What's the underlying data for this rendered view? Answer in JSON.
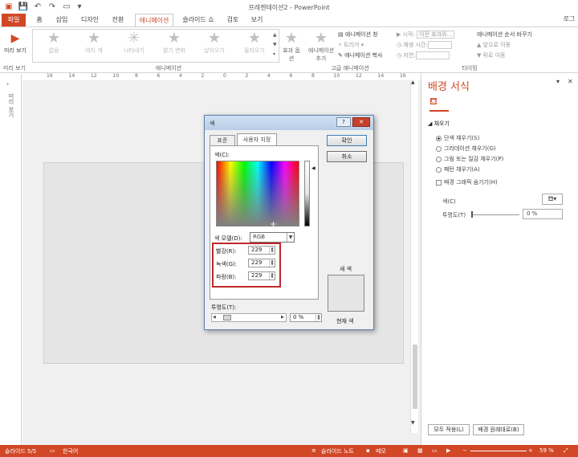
{
  "window": {
    "title": "프레젠테이션2 - PowerPoint",
    "login": "로그인"
  },
  "tabs": [
    {
      "label": "파일",
      "kind": "file"
    },
    {
      "label": "홈",
      "kind": ""
    },
    {
      "label": "삽입",
      "kind": ""
    },
    {
      "label": "디자인",
      "kind": ""
    },
    {
      "label": "전환",
      "kind": ""
    },
    {
      "label": "애니메이션",
      "kind": "active"
    },
    {
      "label": "슬라이드 쇼",
      "kind": ""
    },
    {
      "label": "검토",
      "kind": ""
    },
    {
      "label": "보기",
      "kind": ""
    }
  ],
  "ribbon": {
    "preview_label": "미리 보기",
    "preview_group": "미리 보기",
    "animations": [
      "없음",
      "여러 개",
      "나타내기",
      "밝기 변화",
      "날아오기",
      "올라오기"
    ],
    "effect_options": "효과 옵션",
    "animation_group": "애니메이션",
    "add_animation": "애니메이션 추가",
    "animation_pane": "애니메이션 창",
    "trigger": "트리거",
    "animation_painter": "애니메이션 복사",
    "advanced_group": "고급 애니메이션",
    "start_label": "시작:",
    "start_value": "이전 효과와...",
    "duration_label": "재생 시간:",
    "delay_label": "지연:",
    "reorder_title": "애니메이션 순서 바꾸기",
    "move_earlier": "앞으로 이동",
    "move_later": "뒤로 이동",
    "timing_group": "타이밍"
  },
  "left_strip": {
    "label": "미리 보기"
  },
  "ruler": {
    "marks": [
      "16",
      "14",
      "12",
      "10",
      "8",
      "6",
      "4",
      "2",
      "0",
      "2",
      "4",
      "6",
      "8",
      "10",
      "12",
      "14",
      "16"
    ]
  },
  "pane": {
    "title": "배경 서식",
    "section": "채우기",
    "options": [
      {
        "label": "단색 채우기(S)",
        "selected": true
      },
      {
        "label": "그라데이션 채우기(G)",
        "selected": false
      },
      {
        "label": "그림 또는 질감 채우기(P)",
        "selected": false
      },
      {
        "label": "패턴 채우기(A)",
        "selected": false
      }
    ],
    "hide_graphics": "배경 그래픽 숨기기(H)",
    "color_label": "색(C)",
    "transparency_label": "투명도(T)",
    "transparency_value": "0 %",
    "apply_all": "모두 적용(L)",
    "reset": "배경 원래대로(B)"
  },
  "dialog": {
    "title": "색",
    "help": "?",
    "close": "✕",
    "tab_standard": "표준",
    "tab_custom": "사용자 지정",
    "colors_label": "색(C):",
    "model_label": "색 모델(D):",
    "model_value": "RGB",
    "red_label": "빨강(R):",
    "red_value": "229",
    "green_label": "녹색(G):",
    "green_value": "229",
    "blue_label": "파랑(B):",
    "blue_value": "229",
    "transparency_label": "투명도(T):",
    "transparency_value": "0 %",
    "ok": "확인",
    "cancel": "취소",
    "new_label": "새 색",
    "current_label": "현재 색",
    "sample_color": "#e5e5e5"
  },
  "status": {
    "slide": "슬라이드 5/5",
    "lang": "한국어",
    "notes": "슬라이드 노트",
    "comments": "메모",
    "zoom": "59 %"
  },
  "colors": {
    "accent": "#d24726",
    "highlight": "#c0282d"
  }
}
